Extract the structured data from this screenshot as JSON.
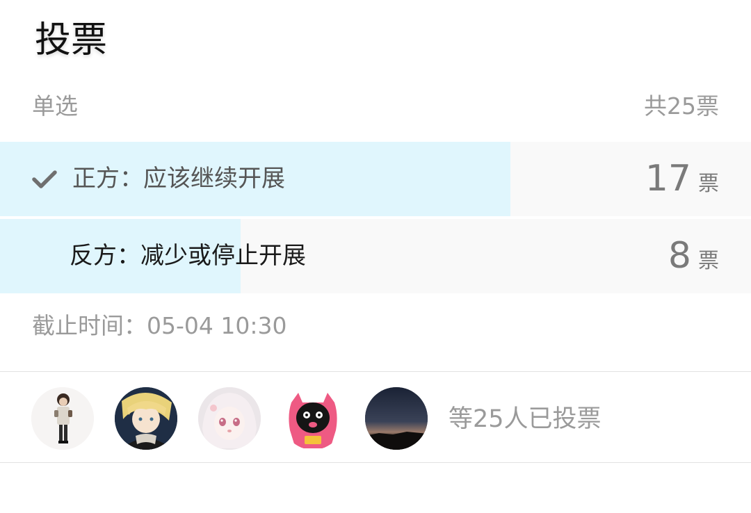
{
  "poll": {
    "title": "投票",
    "mode": "单选",
    "total": "共25票",
    "options": [
      {
        "label": "正方：应该继续开展",
        "votes": "17",
        "unit": "票",
        "fraction": 0.68,
        "selected": true,
        "check_icon": "check-icon"
      },
      {
        "label": "反方：减少或停止开展",
        "votes": "8",
        "unit": "票",
        "fraction": 0.32,
        "selected": false
      }
    ],
    "deadline": "截止时间：05-04 10:30",
    "voters": {
      "summary": "等25人已投票",
      "avatars": [
        "avatar-1",
        "avatar-2",
        "avatar-3",
        "avatar-4",
        "avatar-5"
      ]
    }
  },
  "colors": {
    "fill": "#e0f6fd",
    "option_bg": "#f9f9f9",
    "muted_text": "#9a9a9a",
    "title_text": "#111111"
  }
}
